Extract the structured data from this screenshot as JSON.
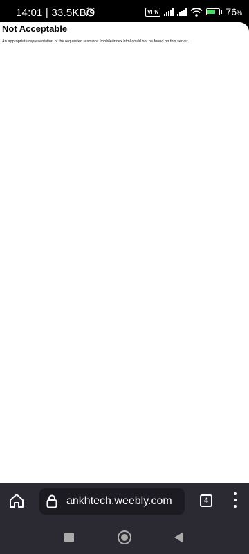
{
  "status_bar": {
    "time_speed": "14:01 | 33.5KB/s",
    "vpn_label": "VPN",
    "battery_percent": "76",
    "battery_unit": "%",
    "battery_level": 0.76,
    "icons": [
      "alarm-icon",
      "vpn-badge",
      "cell-signal-icon",
      "cell-signal-icon",
      "wifi-icon",
      "battery-charging-icon"
    ]
  },
  "page": {
    "heading": "Not Acceptable",
    "message": "An appropriate representation of the requested resource /mobile/index.html could not be found on this server."
  },
  "toolbar": {
    "url": "ankhtech.weebly.com",
    "tab_count": "4",
    "icons": [
      "home-icon",
      "lock-icon",
      "tabs-counter",
      "menu-icon"
    ]
  },
  "nav_bar": {
    "icons": [
      "recents-icon",
      "home-circle-icon",
      "back-icon"
    ]
  },
  "colors": {
    "toolbar_bg": "#2b2a33",
    "url_bar_bg": "#1c1b22",
    "battery_green": "#4cd964"
  }
}
